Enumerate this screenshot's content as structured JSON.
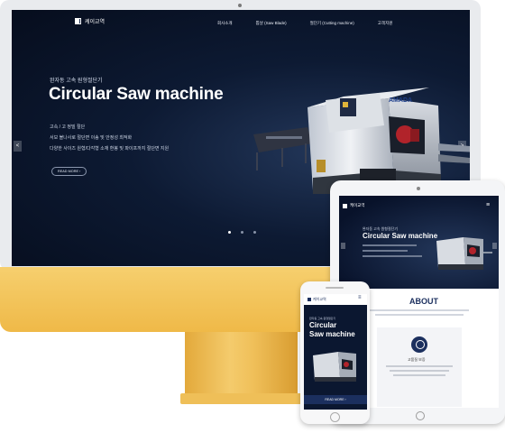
{
  "site": {
    "logo_text": "케이교역",
    "nav": [
      "회사소개",
      "톱날 (Saw Blade)",
      "절단기 (Cutting machine)",
      "고객지원"
    ],
    "subtitle": "완자동 고속 원형절단기",
    "headline": "Circular Saw machine",
    "bullets": [
      "고속 / 고 정밀 절단",
      "서보 볼나사로 절단면 이송 및 안정성 최적화",
      "다양한 사이즈 원형/다각형 소재 환봉 및 파이프까지 절단면 지원"
    ],
    "read_more": "READ MORE",
    "arrow_prev": "<",
    "arrow_next": ">"
  },
  "tablet": {
    "subtitle": "완자동 고속 원형절단기",
    "headline": "Circular Saw machine",
    "about_title": "ABOUT",
    "card_title": "고품질 보증"
  },
  "phone": {
    "headline_line1": "Circular",
    "headline_line2": "Saw machine",
    "read_more": "READ MORE"
  },
  "colors": {
    "imac_yellow": "#f2c35a",
    "hero_navy": "#0d1a33",
    "about_navy": "#1b2f5e"
  }
}
